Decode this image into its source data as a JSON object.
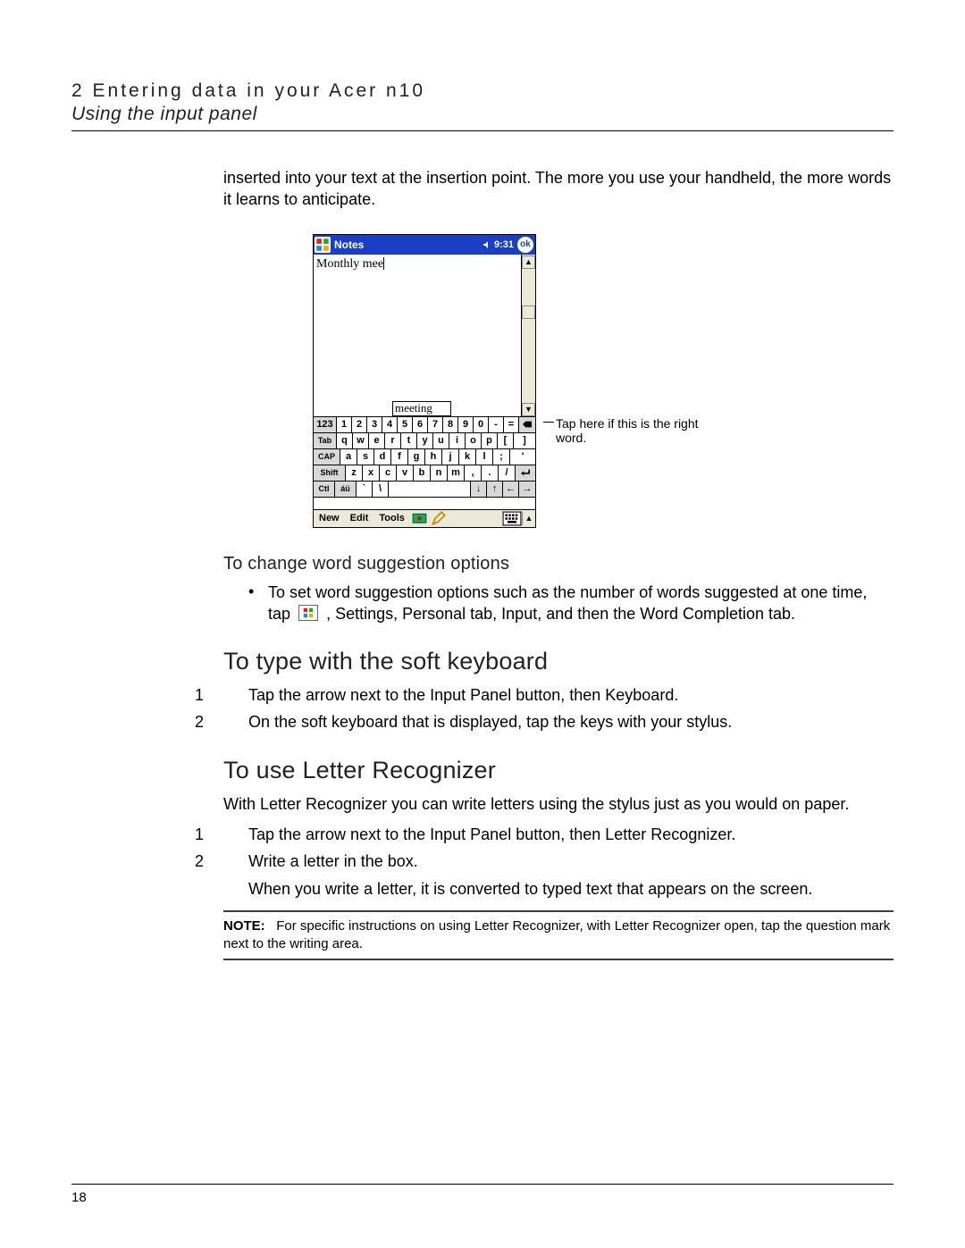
{
  "header": {
    "chapter": "2 Entering data in your Acer n10",
    "section": "Using the input panel"
  },
  "intro_paragraph": "inserted into your text at the insertion point. The more you use your handheld, the more words it learns to anticipate.",
  "pda": {
    "app_title": "Notes",
    "time": "9:31",
    "ok_label": "ok",
    "doc_text": "Monthly mee",
    "suggestion": "meeting",
    "keyboard": {
      "row1": [
        "123",
        "1",
        "2",
        "3",
        "4",
        "5",
        "6",
        "7",
        "8",
        "9",
        "0",
        "-",
        "=",
        "◆"
      ],
      "row2": [
        "Tab",
        "q",
        "w",
        "e",
        "r",
        "t",
        "y",
        "u",
        "i",
        "o",
        "p",
        "[",
        "]"
      ],
      "row3": [
        "CAP",
        "a",
        "s",
        "d",
        "f",
        "g",
        "h",
        "j",
        "k",
        "l",
        ";",
        "'"
      ],
      "row4": [
        "Shift",
        "z",
        "x",
        "c",
        "v",
        "b",
        "n",
        "m",
        ",",
        ".",
        "/",
        "↵"
      ],
      "row5": [
        "Ctl",
        "áü",
        "`",
        "\\",
        "",
        "↓",
        "↑",
        "←",
        "→"
      ]
    },
    "bottombar": {
      "items": [
        "New",
        "Edit",
        "Tools"
      ],
      "icons": [
        "record-icon",
        "pen-icon",
        "keyboard-icon",
        "menu-up-icon"
      ]
    }
  },
  "callout": "Tap here if this is the right word.",
  "sections": {
    "change_options": {
      "heading": "To change word suggestion options",
      "bullet_pre": "To set word suggestion options such as the number of words suggested at one time, tap",
      "bullet_post": ", Settings, Personal tab, Input, and then the Word Completion tab."
    },
    "soft_keyboard": {
      "heading": "To type with the soft keyboard",
      "steps": [
        "Tap the arrow next to the Input Panel button, then Keyboard.",
        "On the soft keyboard that is displayed, tap the keys with your stylus."
      ]
    },
    "letter_recognizer": {
      "heading": "To use Letter Recognizer",
      "intro": "With Letter Recognizer you can write letters using the stylus just as you would on paper.",
      "steps": [
        "Tap the arrow next to the Input Panel button, then Letter Recognizer.",
        "Write a letter in the box."
      ],
      "after_steps": "When you write a letter, it is converted to typed text that appears on the screen.",
      "note_label": "NOTE:",
      "note_body": "For specific instructions on using Letter Recognizer, with Letter Recognizer open, tap the question mark next to the writing area."
    }
  },
  "page_number": "18"
}
